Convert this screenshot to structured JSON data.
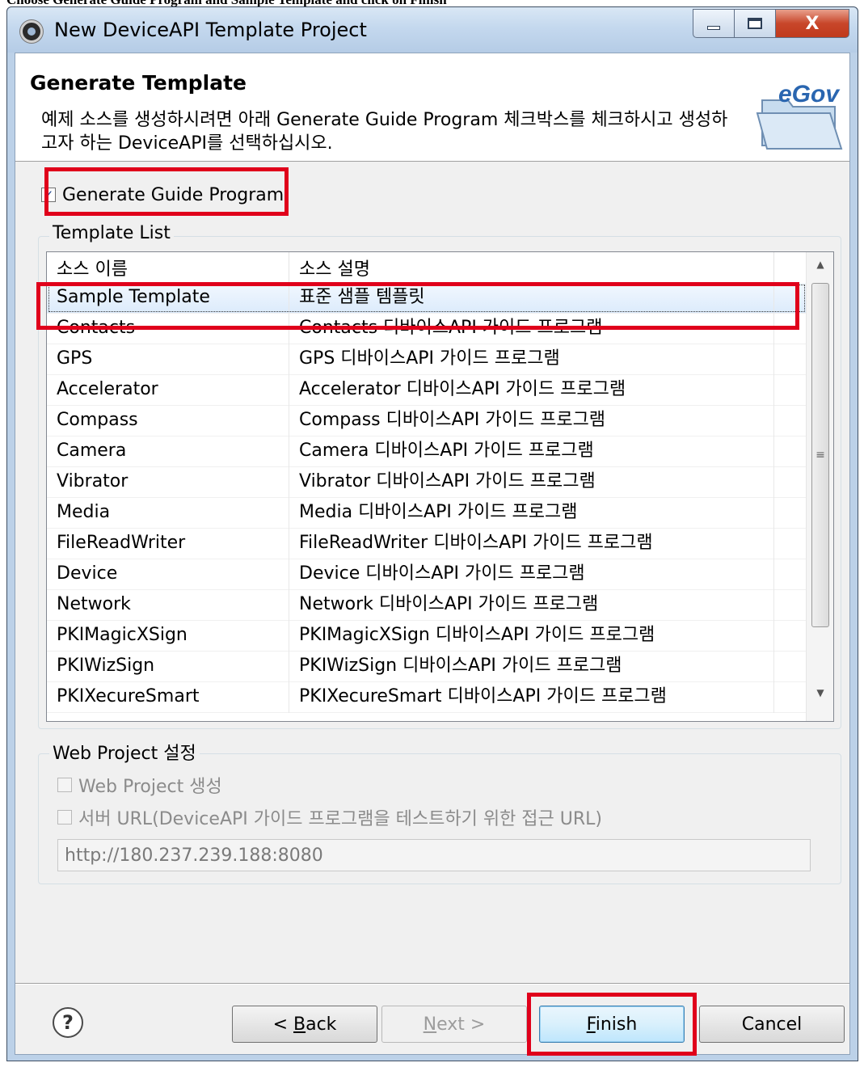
{
  "caption": "Choose Generate Guide Program and Sample Template and click on Finish",
  "window": {
    "title": "New DeviceAPI Template Project",
    "close_glyph": "X"
  },
  "header": {
    "title": "Generate Template",
    "description": "예제 소스를 생성하시려면 아래 Generate Guide Program 체크박스를 체크하시고 생성하고자 하는 DeviceAPI를 선택하십시오.",
    "logo_text": "eGov"
  },
  "generate_guide": {
    "label": "Generate Guide Program",
    "checked": true,
    "check_glyph": "✓"
  },
  "template_list": {
    "legend": "Template List",
    "columns": [
      "소스 이름",
      "소스 설명"
    ],
    "rows": [
      {
        "name": "Sample Template",
        "desc": "표준 샘플 템플릿",
        "selected": true
      },
      {
        "name": "Contacts",
        "desc": "Contacts 디바이스API 가이드 프로그램"
      },
      {
        "name": "GPS",
        "desc": "GPS 디바이스API 가이드 프로그램"
      },
      {
        "name": "Accelerator",
        "desc": "Accelerator 디바이스API 가이드 프로그램"
      },
      {
        "name": "Compass",
        "desc": "Compass 디바이스API 가이드 프로그램"
      },
      {
        "name": "Camera",
        "desc": "Camera 디바이스API 가이드 프로그램"
      },
      {
        "name": "Vibrator",
        "desc": "Vibrator 디바이스API 가이드 프로그램"
      },
      {
        "name": "Media",
        "desc": "Media 디바이스API 가이드 프로그램"
      },
      {
        "name": "FileReadWriter",
        "desc": "FileReadWriter 디바이스API 가이드 프로그램"
      },
      {
        "name": "Device",
        "desc": "Device 디바이스API 가이드 프로그램"
      },
      {
        "name": "Network",
        "desc": "Network 디바이스API 가이드 프로그램"
      },
      {
        "name": "PKIMagicXSign",
        "desc": "PKIMagicXSign 디바이스API 가이드 프로그램"
      },
      {
        "name": "PKIWizSign",
        "desc": "PKIWizSign 디바이스API 가이드 프로그램"
      },
      {
        "name": "PKIXecureSmart",
        "desc": "PKIXecureSmart 디바이스API 가이드 프로그램"
      }
    ],
    "scroll_up_glyph": "▲",
    "scroll_down_glyph": "▼",
    "scroll_grip_glyph": "≡"
  },
  "web_project": {
    "legend": "Web Project 설정",
    "create_label": "Web Project 생성",
    "create_checked": false,
    "server_label": "서버 URL(DeviceAPI 가이드 프로그램을 테스트하기 위한 접근 URL)",
    "server_checked": false,
    "url_value": "http://180.237.239.188:8080"
  },
  "buttons": {
    "help_glyph": "?",
    "back_prefix": "< ",
    "back_mnemonic": "B",
    "back_rest": "ack",
    "next_mnemonic": "N",
    "next_rest": "ext >",
    "finish_mnemonic": "F",
    "finish_rest": "inish",
    "cancel": "Cancel"
  },
  "colors": {
    "highlight_red": "#e0001b",
    "selection": "#dcebfc",
    "titlebar": "#c4d8ee",
    "close_button": "#c8462a"
  }
}
